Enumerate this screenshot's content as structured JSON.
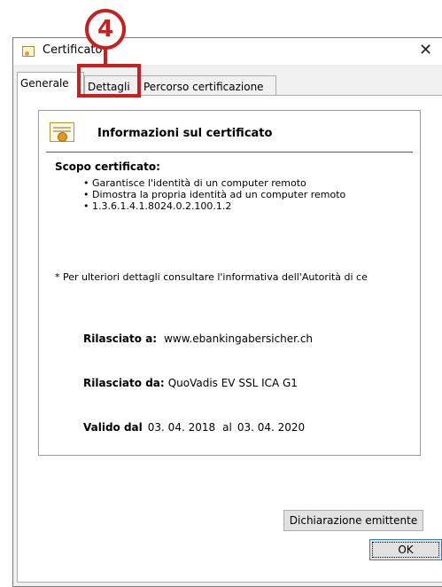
{
  "window": {
    "title": "Certificato",
    "close_glyph": "✕"
  },
  "tabs": [
    {
      "label": "Generale",
      "selected": true
    },
    {
      "label": "Dettagli",
      "selected": false
    },
    {
      "label": "Percorso certificazione",
      "selected": false
    }
  ],
  "info": {
    "title": "Informazioni sul certificato",
    "scope_heading": "Scopo certificato:",
    "purposes": [
      "• Garantisce l'identità di un computer remoto",
      "• Dimostra la propria identità ad un computer remoto",
      "• 1.3.6.1.4.1.8024.0.2.100.1.2"
    ],
    "footnote": "* Per ulteriori dettagli consultare l'informativa dell'Autorità di ce",
    "issued_to_label": "Rilasciato a:",
    "issued_to_value": "www.ebankingabersicher.ch",
    "issued_by_label": "Rilasciato da:",
    "issued_by_value": "QuoVadis EV SSL ICA G1",
    "valid_label": "Valido dal",
    "valid_from": "03. 04. 2018",
    "valid_to_label": "al",
    "valid_to": "03. 04. 2020"
  },
  "buttons": {
    "issuer_statement": "Dichiarazione emittente",
    "ok": "OK"
  },
  "annotation": {
    "step_number": "4",
    "accent_color": "#c8201f"
  }
}
